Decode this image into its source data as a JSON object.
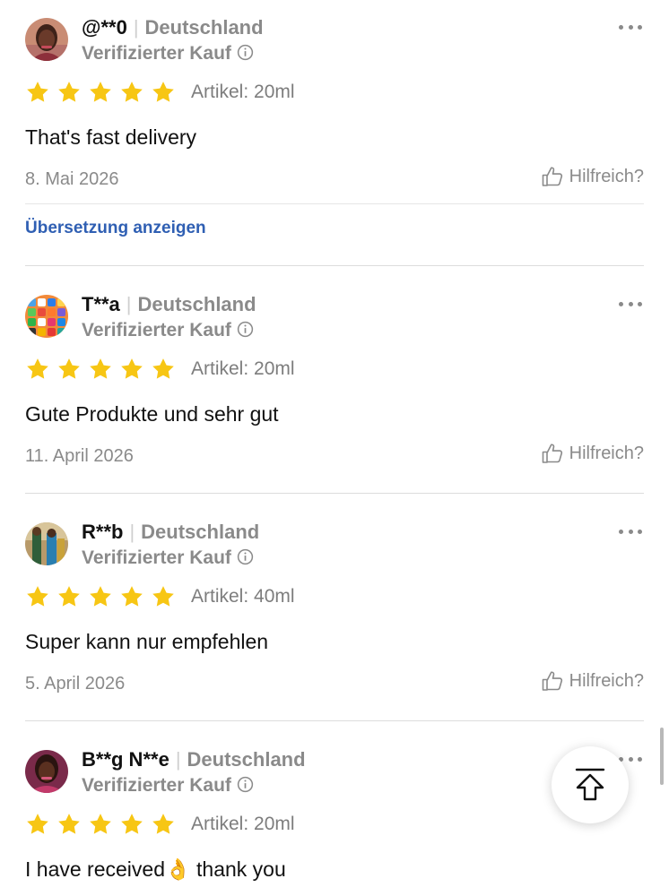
{
  "reviews": [
    {
      "username": "@**0",
      "country": "Deutschland",
      "verified": "Verifizierter Kauf",
      "rating": 5,
      "item": "Artikel: 20ml",
      "text": "That's fast delivery",
      "date": "8. Mai 2026",
      "helpful": "Hilfreich?",
      "translate": "Übersetzung anzeigen",
      "avatar": "woman-portrait-avatar"
    },
    {
      "username": "T**a",
      "country": "Deutschland",
      "verified": "Verifizierter Kauf",
      "rating": 5,
      "item": "Artikel: 20ml",
      "text": "Gute Produkte und sehr gut",
      "date": "11. April 2026",
      "helpful": "Hilfreich?",
      "avatar": "app-grid-avatar"
    },
    {
      "username": "R**b",
      "country": "Deutschland",
      "verified": "Verifizierter Kauf",
      "rating": 5,
      "item": "Artikel: 40ml",
      "text": "Super kann nur empfehlen",
      "date": "5. April 2026",
      "helpful": "Hilfreich?",
      "avatar": "people-photo-avatar"
    },
    {
      "username": "B**g N**e",
      "country": "Deutschland",
      "verified": "Verifizierter Kauf",
      "rating": 5,
      "item": "Artikel: 20ml",
      "text_before": "I have received",
      "text_emoji": "👌",
      "text_after": " thank you",
      "avatar": "woman-portrait-avatar"
    }
  ],
  "icons": {
    "star": "star-icon",
    "info": "info-icon",
    "more": "more-icon",
    "thumbs_up": "thumbs-up-icon",
    "back_to_top": "back-to-top-icon"
  },
  "colors": {
    "star": "#f7c614",
    "link": "#2f5fb3",
    "muted": "#8a8a8a"
  }
}
